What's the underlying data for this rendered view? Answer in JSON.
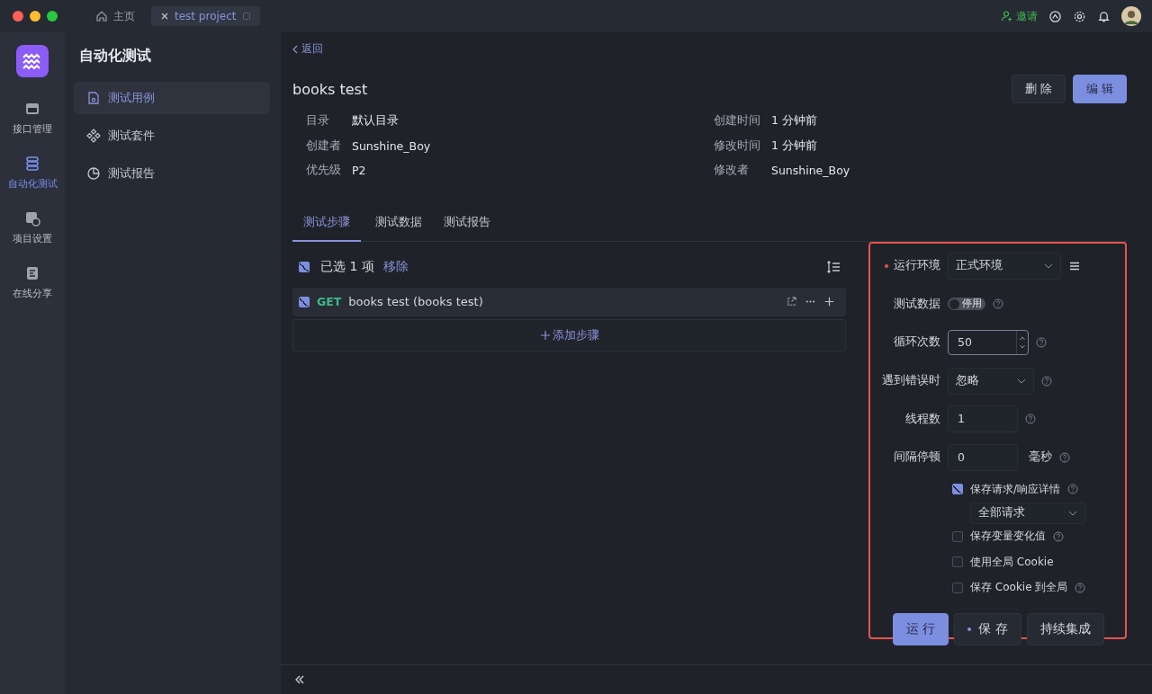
{
  "window": {
    "tabs": [
      {
        "kind": "home",
        "label": "主页",
        "selected": false
      },
      {
        "kind": "project",
        "label": "test project",
        "selected": true
      }
    ],
    "invite": "邀请"
  },
  "rail": [
    {
      "kind": "api",
      "label": "接口管理",
      "selected": false
    },
    {
      "kind": "auto",
      "label": "自动化测试",
      "selected": true
    },
    {
      "kind": "settings",
      "label": "项目设置",
      "selected": false
    },
    {
      "kind": "share",
      "label": "在线分享",
      "selected": false
    }
  ],
  "sidebar": {
    "title": "自动化测试",
    "items": [
      {
        "kind": "case",
        "label": "测试用例",
        "selected": true
      },
      {
        "kind": "suite",
        "label": "测试套件",
        "selected": false
      },
      {
        "kind": "report",
        "label": "测试报告",
        "selected": false
      }
    ]
  },
  "detail": {
    "back": "返回",
    "title": "books test",
    "delete": "删 除",
    "edit": "编 辑",
    "meta_left": [
      {
        "label": "目录",
        "value": "默认目录"
      },
      {
        "label": "创建者",
        "value": "Sunshine_Boy"
      },
      {
        "label": "优先级",
        "value": "P2"
      }
    ],
    "meta_right": [
      {
        "label": "创建时间",
        "value": "1 分钟前"
      },
      {
        "label": "修改时间",
        "value": "1 分钟前"
      },
      {
        "label": "修改者",
        "value": "Sunshine_Boy"
      }
    ]
  },
  "tabs": [
    {
      "label": "测试步骤",
      "selected": true
    },
    {
      "label": "测试数据",
      "selected": false
    },
    {
      "label": "测试报告",
      "selected": false
    }
  ],
  "steps": {
    "all_checked": true,
    "selection": "已选 1 项",
    "remove": "移除",
    "add": "添加步骤",
    "items": [
      {
        "method": "GET",
        "name": "books test (books test)",
        "checked": true
      }
    ]
  },
  "run_panel": {
    "environment": {
      "label": "运行环境",
      "required": true,
      "value": "正式环境"
    },
    "test_data": {
      "label": "测试数据",
      "on": false,
      "text": "停用"
    },
    "loops": {
      "label": "循环次数",
      "value": "50"
    },
    "on_error": {
      "label": "遇到错误时",
      "value": "忽略"
    },
    "threads": {
      "label": "线程数",
      "value": "1"
    },
    "interval": {
      "label": "间隔停顿",
      "value": "0",
      "unit": "毫秒"
    },
    "options": [
      {
        "label": "保存请求/响应详情",
        "checked": true,
        "help": true,
        "select": "全部请求"
      },
      {
        "label": "保存变量变化值",
        "checked": false,
        "help": true
      },
      {
        "label": "使用全局 Cookie",
        "checked": false,
        "help": false
      },
      {
        "label": "保存 Cookie 到全局",
        "checked": false,
        "help": true
      }
    ],
    "run": "运 行",
    "save": "保 存",
    "ci": "持续集成"
  }
}
